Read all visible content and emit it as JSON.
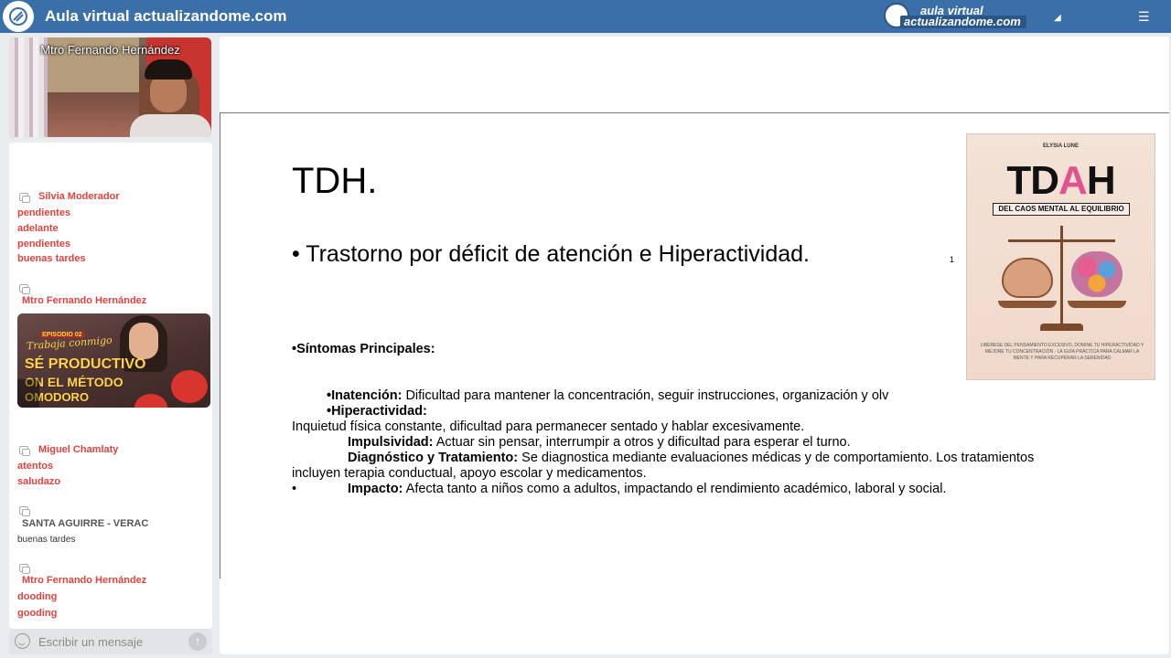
{
  "topbar": {
    "title": "Aula virtual actualizandome.com",
    "brand_top": "aula virtual",
    "brand_bottom": "actualizandome.com",
    "icons": [
      "app-logo-icon",
      "collapse-icon",
      "menu-icon"
    ]
  },
  "video": {
    "presenter": "Mtro Fernando Hernández"
  },
  "chat": {
    "messages": [
      {
        "user": "Silvia Moderador",
        "lines": [
          "pendientes",
          "adelante",
          "pendientes",
          "buenas tardes"
        ]
      },
      {
        "user": "Mtro Fernando Hernández",
        "lines": []
      },
      {
        "user": "Miguel Chamlaty",
        "lines": [
          "atentos",
          "saludazo"
        ]
      },
      {
        "user": "SANTA AGUIRRE - VERAC",
        "lines": [
          "buenas tardes"
        ]
      },
      {
        "user": "Mtro Fernando Hernández",
        "lines": [
          "dooding",
          "gooding"
        ]
      }
    ],
    "thumbnail": {
      "episode": "EPISODIO 02",
      "line1": "Trabaja conmigo",
      "line2": "SÉ PRODUCTIVO",
      "line3": "ON EL MÉTODO",
      "line4": "OMODORO"
    },
    "input_placeholder": "Escribir un mensaje"
  },
  "slide": {
    "title": "TDH.",
    "bullet": "•  Trastorno  por déficit  de atención e Hiperactividad.",
    "footnote": "1",
    "heading": "•Síntomas Principales:",
    "inatencion_label": "•Inatención:",
    "inatencion_text": " Dificultad para mantener la concentración, seguir instrucciones, organización y olv",
    "hiper_label": "•Hiperactividad:",
    "hiper_text": "Inquietud física constante, dificultad para permanecer sentado y hablar excesivamente.",
    "impulsividad_label": "Impulsividad:",
    "impulsividad_text": " Actuar sin pensar, interrumpir a otros y dificultad para esperar el turno.",
    "diag_label": "Diagnóstico y Tratamiento:",
    "diag_text": " Se diagnostica mediante evaluaciones médicas y de comportamiento. Los tratamientos",
    "diag_text2": "incluyen terapia conductual, apoyo escolar y medicamentos.",
    "impacto_bullet": "•",
    "impacto_label": "Impacto:",
    "impacto_text": " Afecta tanto a niños como a adultos, impactando el rendimiento académico, laboral y social."
  },
  "book": {
    "author": "ELYSIA LUNE",
    "title_dark": "TD",
    "title_pink": "A",
    "title_dark2": "H",
    "subtitle": "DEL CAOS MENTAL AL EQUILIBRIO",
    "blurb": "LIBÉRESE DEL PENSAMIENTO EXCESIVO, DOMINE TU HIPERACTIVIDAD Y MEJORE TU CONCENTRACIÓN · LA GUÍA PRÁCTICA PARA CALMAR LA MENTE Y PARA RECUPERAR LA SERENIDAD"
  },
  "colors": {
    "topbar": "#3b6fa8",
    "username": "#e0433e",
    "book_pink": "#e1538f"
  }
}
